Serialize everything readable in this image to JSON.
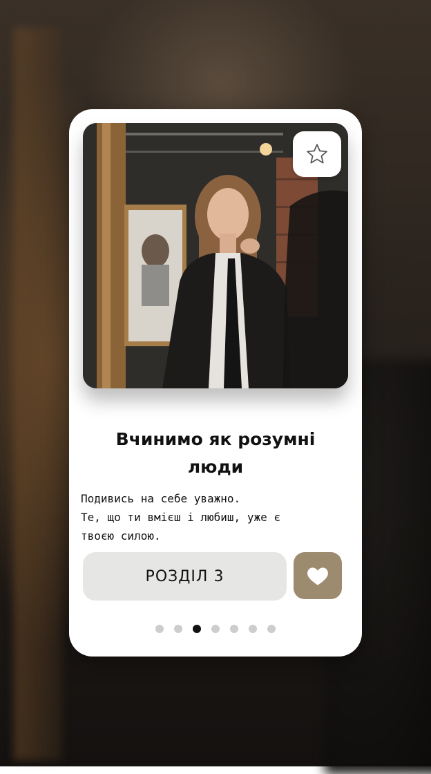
{
  "story": {
    "title_line1": "Вчинимо як розумні",
    "title_line2": "люди",
    "description_lines": [
      "Подивись на себе уважно.",
      "Те, що ти вмієш і любиш, уже є",
      "твоєю силою."
    ]
  },
  "actions": {
    "chapter_label": "РОЗДІЛ 3",
    "favorite_icon": "star-outline-icon",
    "like_icon": "heart-icon"
  },
  "pagination": {
    "total": 7,
    "active_index": 2
  },
  "colors": {
    "accent": "#9d8b70",
    "chapter_button_bg": "#e6e6e5",
    "active_dot": "#111111",
    "inactive_dot": "#cdcdcd"
  }
}
